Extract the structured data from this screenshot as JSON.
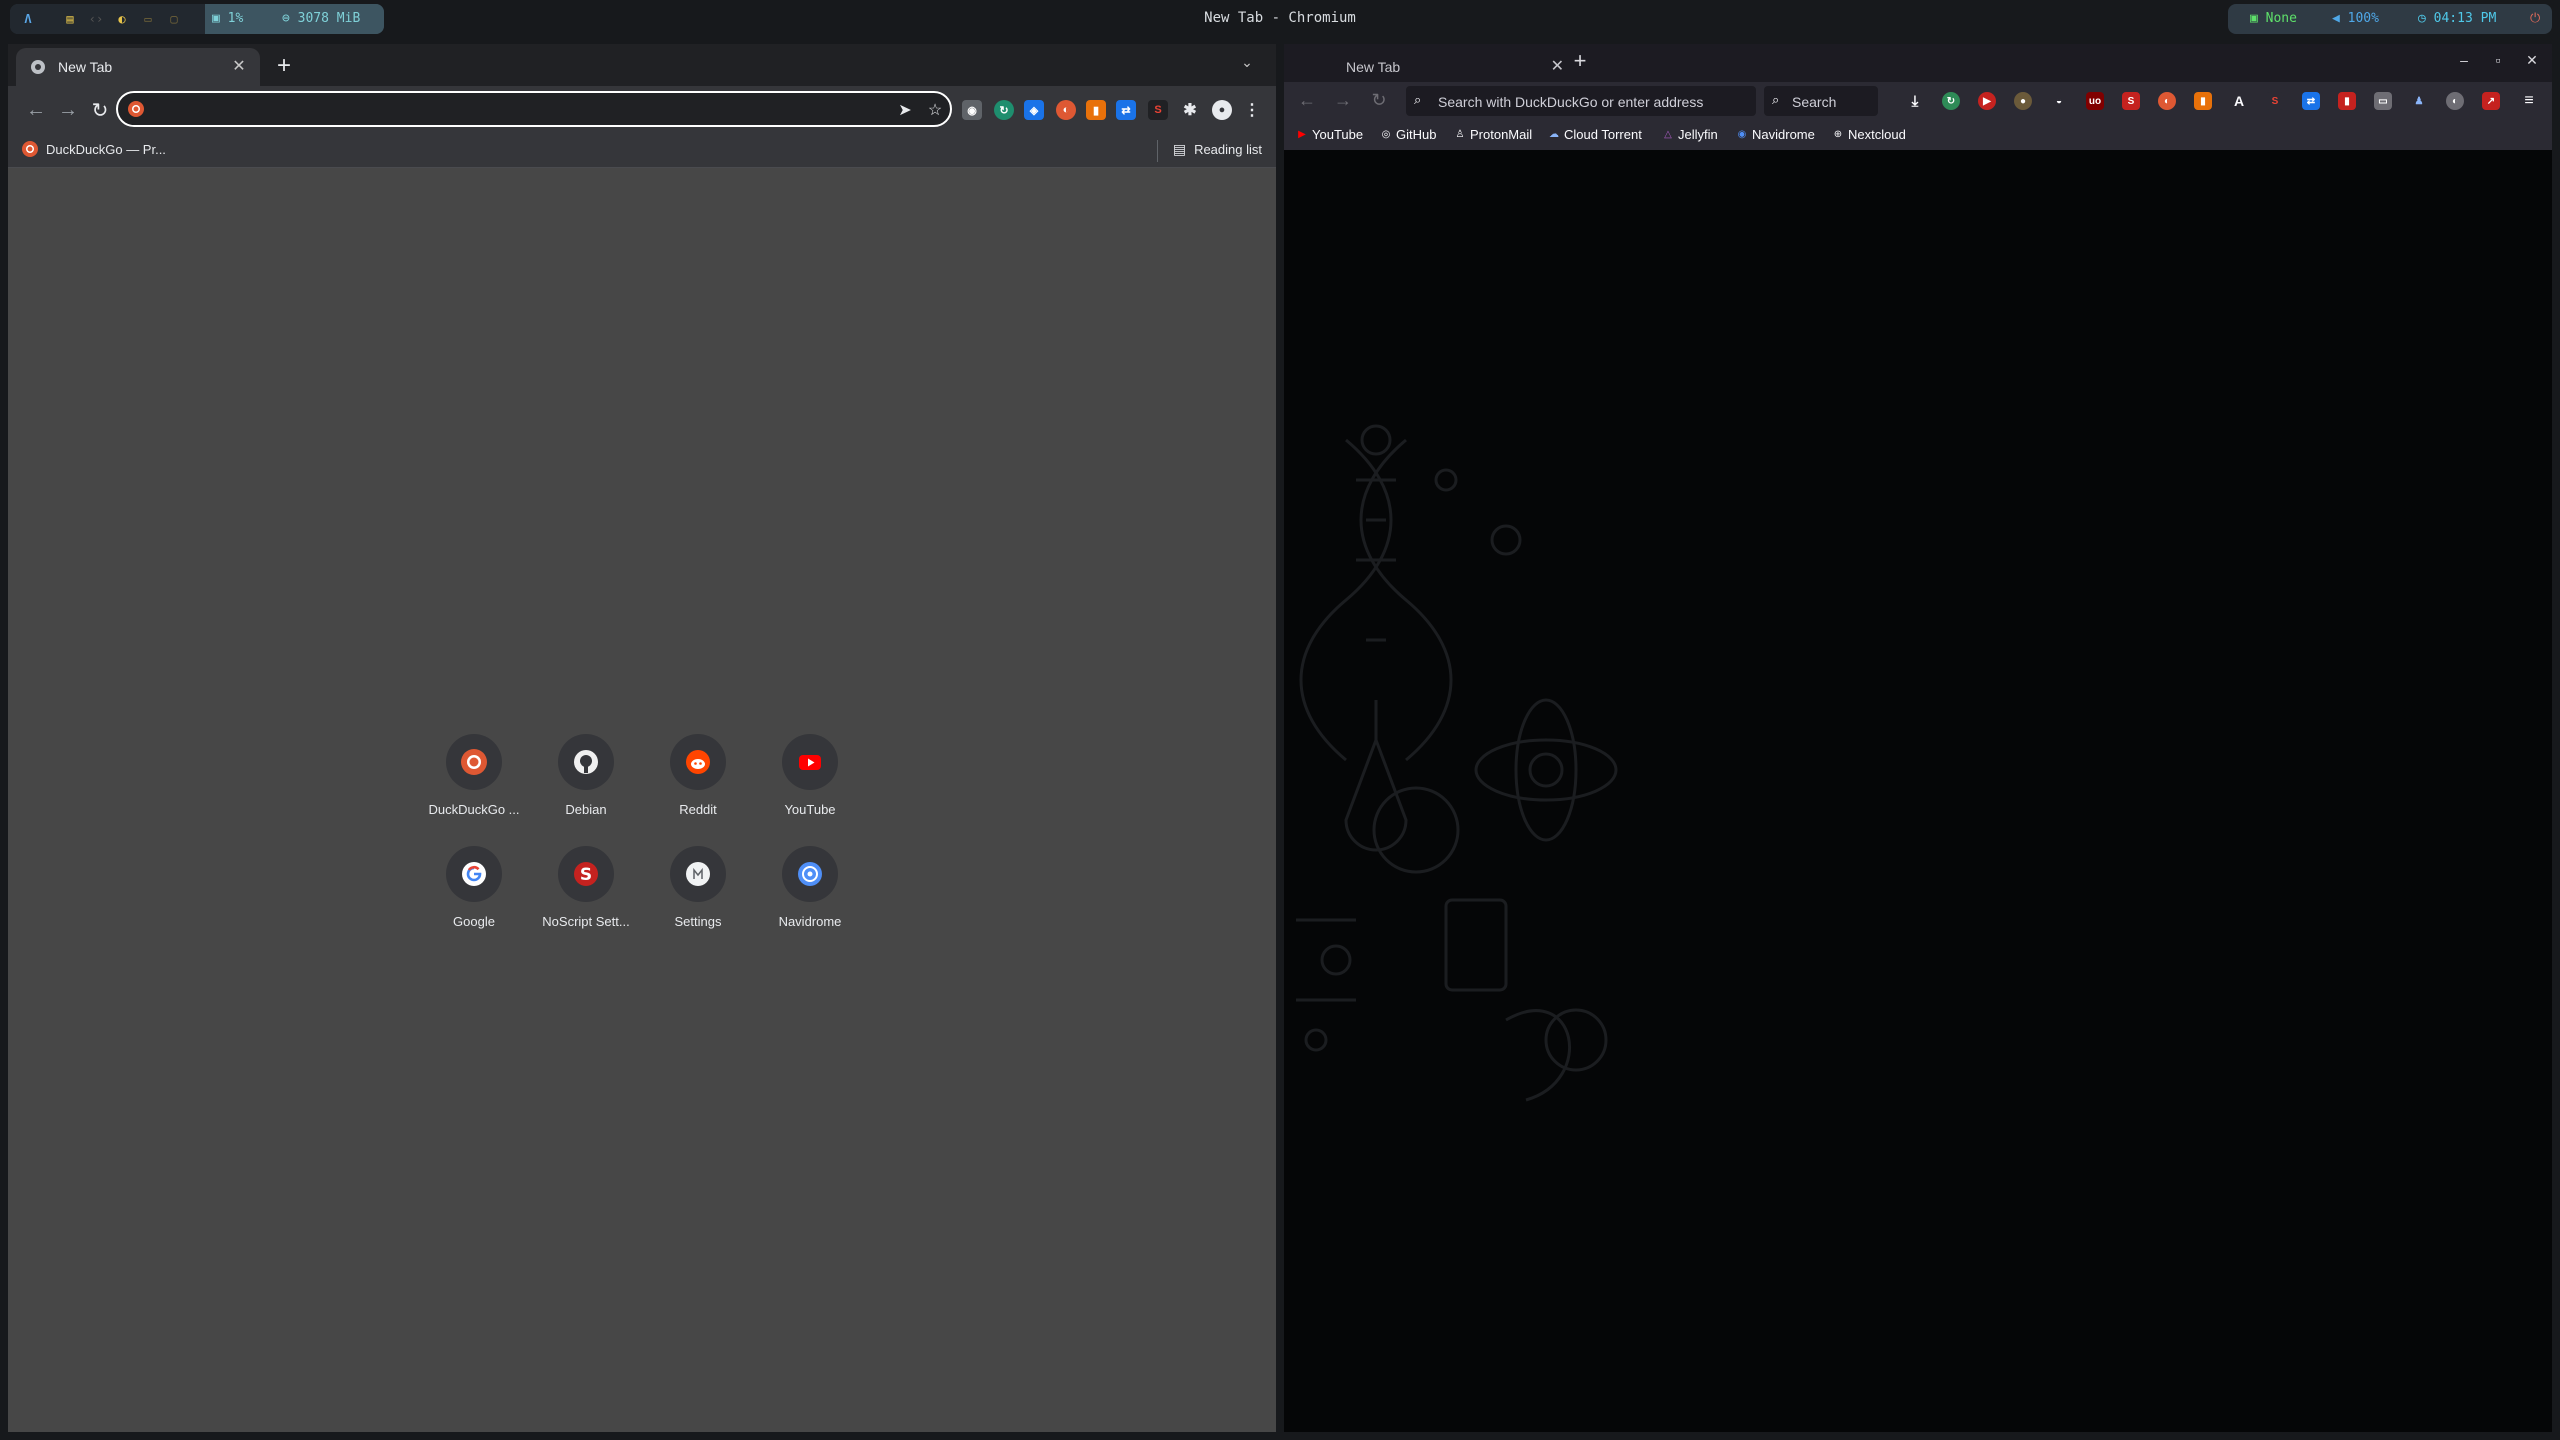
{
  "topbar": {
    "window_title": "New Tab - Chromium",
    "cpu": "1%",
    "memory": "3078 MiB",
    "network": "None",
    "volume": "100%",
    "time": "04:13 PM"
  },
  "chromium": {
    "tab_title": "New Tab",
    "omnibox_value": "",
    "bookmarks": [
      {
        "label": "DuckDuckGo — Pr..."
      }
    ],
    "reading_list": "Reading list",
    "shortcuts": [
      {
        "label": "DuckDuckGo ...",
        "icon": "duckduckgo-icon"
      },
      {
        "label": "Debian",
        "icon": "github-icon"
      },
      {
        "label": "Reddit",
        "icon": "reddit-icon"
      },
      {
        "label": "YouTube",
        "icon": "youtube-icon"
      },
      {
        "label": "Google",
        "icon": "google-icon"
      },
      {
        "label": "NoScript Sett...",
        "icon": "noscript-icon"
      },
      {
        "label": "Settings",
        "icon": "settings-icon"
      },
      {
        "label": "Navidrome",
        "icon": "navidrome-icon"
      }
    ]
  },
  "firefox": {
    "tab_title": "New Tab",
    "url_placeholder": "Search with DuckDuckGo or enter address",
    "search_placeholder": "Search",
    "bookmarks": [
      {
        "label": "YouTube"
      },
      {
        "label": "GitHub"
      },
      {
        "label": "ProtonMail"
      },
      {
        "label": "Cloud Torrent"
      },
      {
        "label": "Jellyfin"
      },
      {
        "label": "Navidrome"
      },
      {
        "label": "Nextcloud"
      }
    ]
  },
  "colors": {
    "chromium_ntp_bg": "#474747",
    "chromium_toolbar": "#35363a",
    "firefox_content_bg": "#050607",
    "accent_teal": "#3d5561",
    "duckduckgo_orange": "#de5833"
  }
}
